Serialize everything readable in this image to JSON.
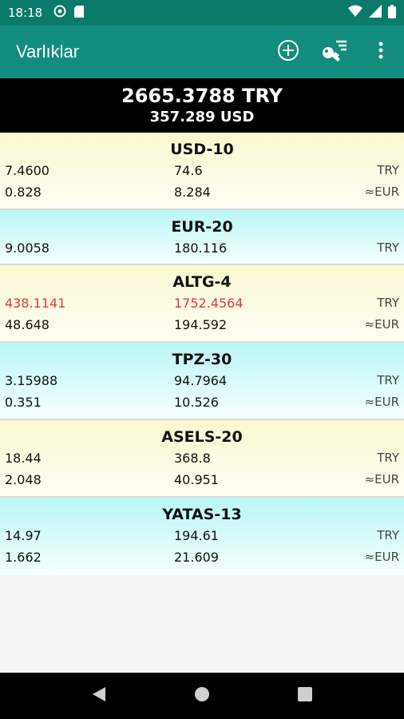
{
  "status_bar": {
    "time": "18:18"
  },
  "app_bar": {
    "title": "Varlıklar"
  },
  "totals": {
    "main": "2665.3788 TRY",
    "sub": "357.289 USD"
  },
  "assets": [
    {
      "name": "USD-10",
      "rows": [
        {
          "a": "7.4600",
          "b": "74.6",
          "unit": "TRY"
        },
        {
          "a": "0.828",
          "b": "8.284",
          "unit": "≈EUR"
        }
      ]
    },
    {
      "name": "EUR-20",
      "rows": [
        {
          "a": "9.0058",
          "b": "180.116",
          "unit": "TRY"
        }
      ]
    },
    {
      "name": "ALTG-4",
      "rows": [
        {
          "a": "438.1141",
          "b": "1752.4564",
          "unit": "TRY"
        },
        {
          "a": "48.648",
          "b": "194.592",
          "unit": "≈EUR"
        }
      ]
    },
    {
      "name": "TPZ-30",
      "rows": [
        {
          "a": "3.15988",
          "b": "94.7964",
          "unit": "TRY"
        },
        {
          "a": "0.351",
          "b": "10.526",
          "unit": "≈EUR"
        }
      ]
    },
    {
      "name": "ASELS-20",
      "rows": [
        {
          "a": "18.44",
          "b": "368.8",
          "unit": "TRY"
        },
        {
          "a": "2.048",
          "b": "40.951",
          "unit": "≈EUR"
        }
      ]
    },
    {
      "name": "YATAS-13",
      "rows": [
        {
          "a": "14.97",
          "b": "194.61",
          "unit": "TRY"
        },
        {
          "a": "1.662",
          "b": "21.609",
          "unit": "≈EUR"
        }
      ]
    }
  ],
  "colors": {
    "app_bar": "#128c7e",
    "status_bar": "#0b7a6b",
    "loss": "#e53935"
  }
}
